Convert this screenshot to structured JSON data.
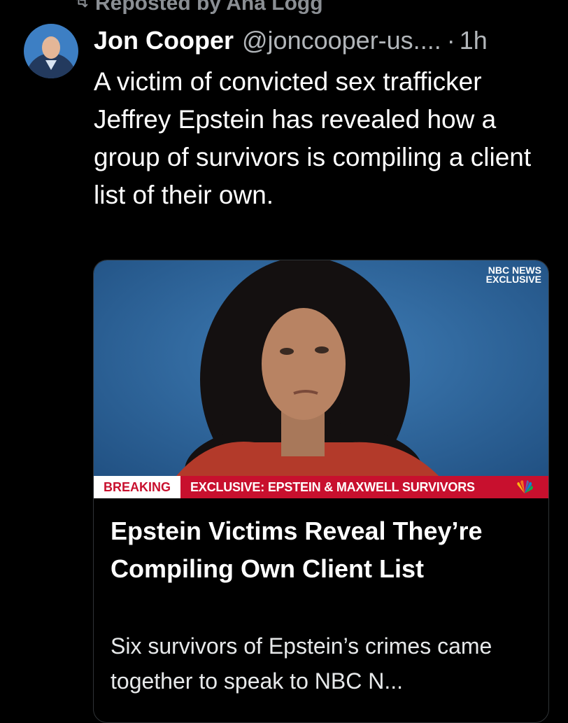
{
  "repost": {
    "label": "Reposted by Ana Logg",
    "icon": "repost-icon"
  },
  "post": {
    "author_name": "Jon Cooper",
    "author_handle": "@joncooper-us....",
    "separator": "·",
    "time": "1h",
    "text": "A victim of convicted sex trafficker Jeffrey Epstein has revealed how a group of survivors is compiling a client list of their own."
  },
  "card": {
    "media": {
      "network_tag_line1": "NBC NEWS",
      "network_tag_line2": "EXCLUSIVE",
      "breaking_label": "BREAKING",
      "ticker_text": "EXCLUSIVE: EPSTEIN & MAXWELL SURVIVORS",
      "logo_icon": "nbc-peacock-icon"
    },
    "title": "Epstein Victims Reveal They’re Compiling Own Client List",
    "description": "Six survivors of Epstein’s crimes came together to speak to NBC N..."
  },
  "colors": {
    "background": "#000000",
    "muted_text": "#b2b6ba",
    "card_border": "#2f3336",
    "nbc_red": "#c8102e"
  }
}
